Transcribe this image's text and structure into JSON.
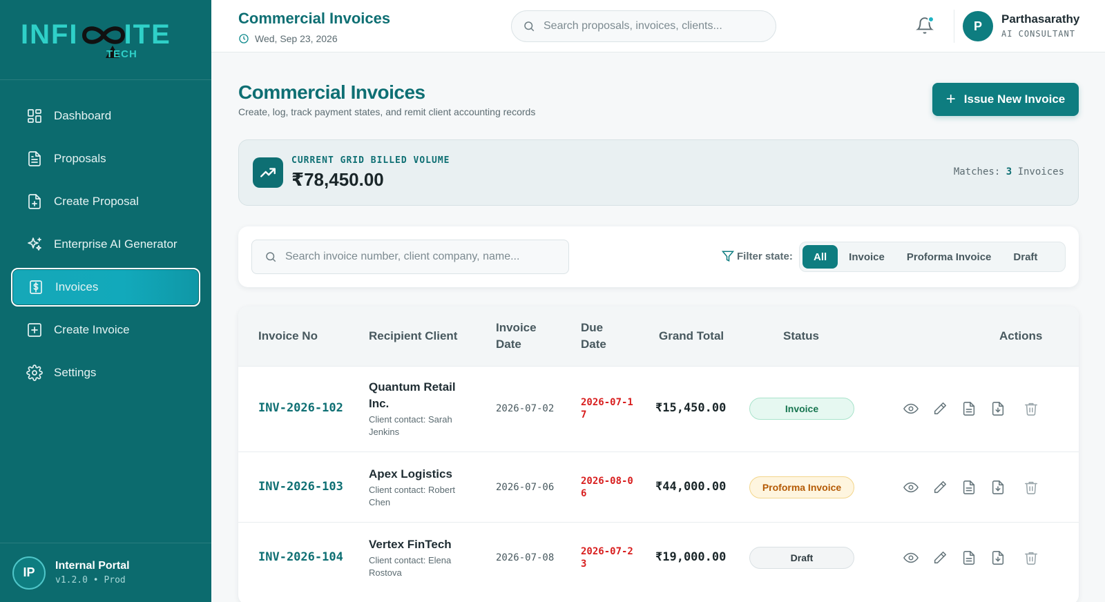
{
  "brand": {
    "logo_main": "INFI",
    "logo_end": "ITE",
    "logo_sub": "TECH",
    "accent": "#0c6b6e",
    "logo_color": "#2fd0c8"
  },
  "sidebar": {
    "items": [
      {
        "label": "Dashboard",
        "icon": "grid-icon"
      },
      {
        "label": "Proposals",
        "icon": "document-icon"
      },
      {
        "label": "Create Proposal",
        "icon": "file-plus-icon"
      },
      {
        "label": "Enterprise AI Generator",
        "icon": "sparkles-icon"
      },
      {
        "label": "Invoices",
        "icon": "dollar-receipt-icon",
        "active": true
      },
      {
        "label": "Create Invoice",
        "icon": "plus-square-icon"
      },
      {
        "label": "Settings",
        "icon": "gear-icon"
      }
    ],
    "footer": {
      "initials": "IP",
      "title": "Internal Portal",
      "version": "v1.2.0 • Prod"
    }
  },
  "topbar": {
    "title": "Commercial Invoices",
    "date": "Wed, Sep 23, 2026",
    "search_placeholder": "Search proposals, invoices, clients...",
    "user": {
      "initial": "P",
      "name": "Parthasarathy",
      "role": "AI CONSULTANT"
    }
  },
  "page": {
    "title": "Commercial Invoices",
    "subtitle": "Create, log, track payment states, and remit client accounting records",
    "issue_button": "Issue New Invoice"
  },
  "volume": {
    "label": "CURRENT GRID BILLED VOLUME",
    "value": "₹78,450.00",
    "matches_prefix": "Matches:",
    "matches_count": "3",
    "matches_suffix": "Invoices"
  },
  "filters": {
    "search_placeholder": "Search invoice number, client company, name...",
    "label": "Filter state:",
    "options": [
      "All",
      "Invoice",
      "Proforma Invoice",
      "Draft"
    ],
    "selected": "All"
  },
  "table": {
    "columns": {
      "invoice_no": "Invoice No",
      "client": "Recipient Client",
      "invoice_date_1": "Invoice",
      "invoice_date_2": "Date",
      "due_date_1": "Due",
      "due_date_2": "Date",
      "grand_total": "Grand Total",
      "status": "Status",
      "actions": "Actions"
    },
    "rows": [
      {
        "invoice_no": "INV-2026-102",
        "client": "Quantum Retail Inc.",
        "contact": "Client contact: Sarah Jenkins",
        "invoice_date": "2026-07-02",
        "due_date": "2026-07-17",
        "grand_total": "₹15,450.00",
        "status": "Invoice"
      },
      {
        "invoice_no": "INV-2026-103",
        "client": "Apex Logistics",
        "contact": "Client contact: Robert Chen",
        "invoice_date": "2026-07-06",
        "due_date": "2026-08-06",
        "grand_total": "₹44,000.00",
        "status": "Proforma Invoice"
      },
      {
        "invoice_no": "INV-2026-104",
        "client": "Vertex FinTech",
        "contact": "Client contact: Elena Rostova",
        "invoice_date": "2026-07-08",
        "due_date": "2026-07-23",
        "grand_total": "₹19,000.00",
        "status": "Draft"
      }
    ]
  }
}
